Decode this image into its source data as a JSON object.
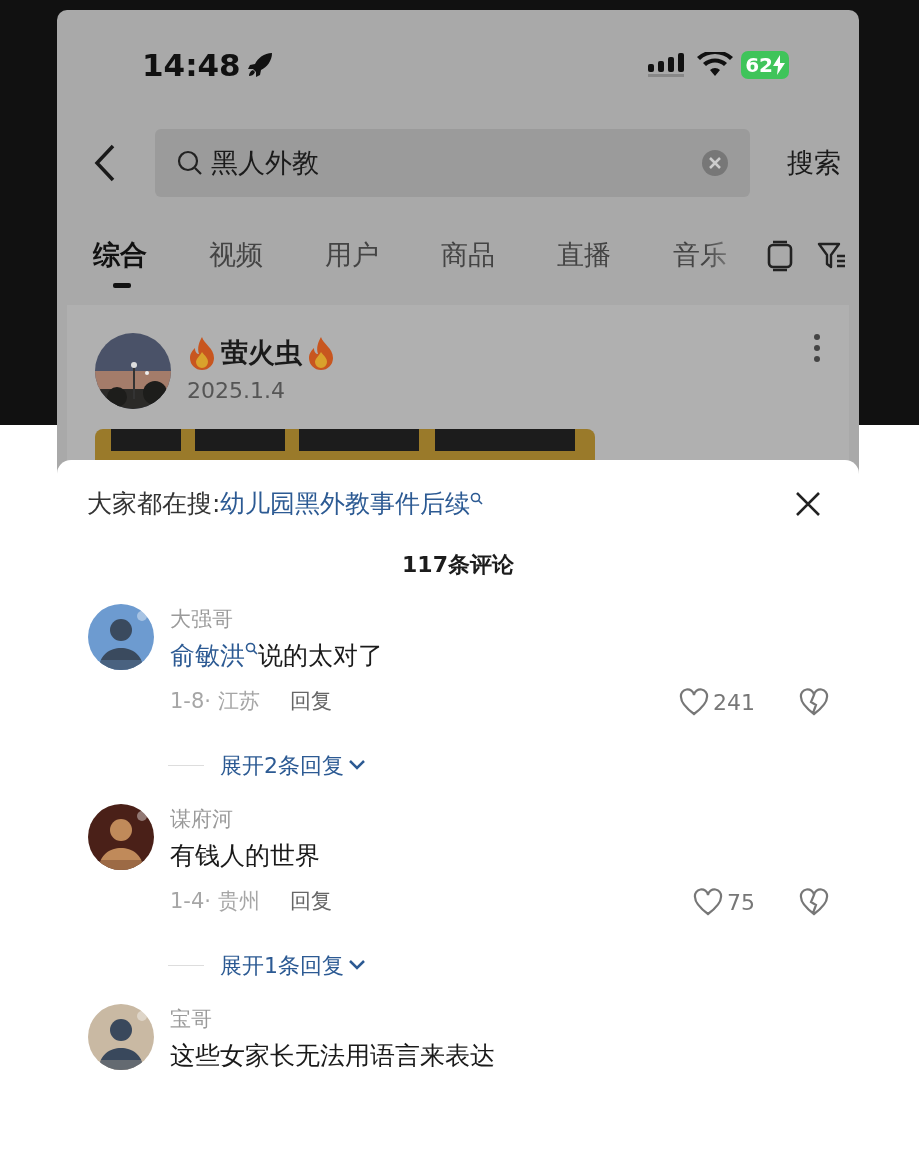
{
  "status_bar": {
    "time": "14:48",
    "battery": "62"
  },
  "search": {
    "value": "黑人外教",
    "button": "搜索"
  },
  "tabs": [
    {
      "label": "综合",
      "selected": true
    },
    {
      "label": "视频",
      "selected": false
    },
    {
      "label": "用户",
      "selected": false
    },
    {
      "label": "商品",
      "selected": false
    },
    {
      "label": "直播",
      "selected": false
    },
    {
      "label": "音乐",
      "selected": false
    }
  ],
  "post": {
    "author": "萤火虫",
    "date": "2025.1.4"
  },
  "comments_panel": {
    "trending_label": "大家都在搜:",
    "trending_query": "幼儿园黑外教事件后续",
    "count": "117条评论"
  },
  "comments": [
    {
      "user": "大强哥",
      "mention": "俞敏洪",
      "text": "说的太对了",
      "meta": "1-8· 江苏",
      "reply": "回复",
      "likes": "241",
      "expand": "展开2条回复"
    },
    {
      "user": "谋府河",
      "text": "有钱人的世界",
      "meta": "1-4· 贵州",
      "reply": "回复",
      "likes": "75",
      "expand": "展开1条回复"
    },
    {
      "user": "宝哥",
      "text": "这些女家长无法用语言来表达"
    }
  ]
}
